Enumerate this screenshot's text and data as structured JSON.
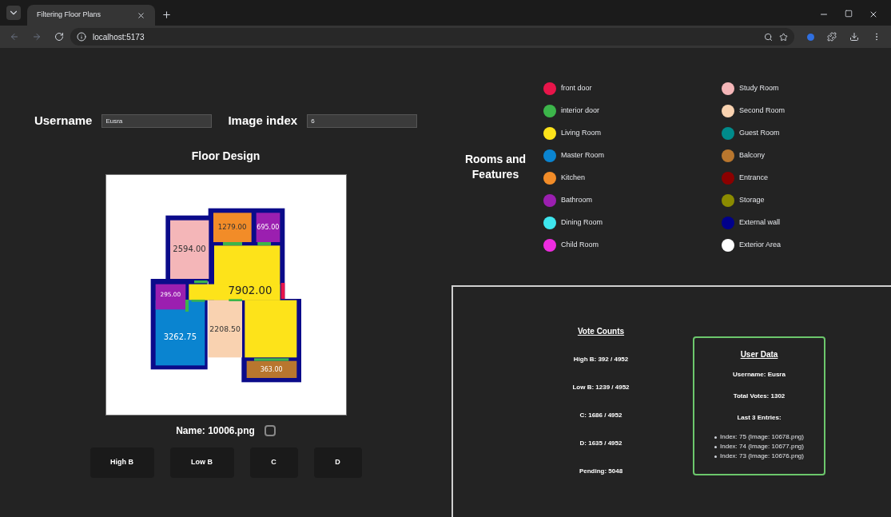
{
  "browser": {
    "tab_title": "Filtering Floor Plans",
    "url": "localhost:5173"
  },
  "form": {
    "username_label": "Username",
    "username_value": "Eusra",
    "image_index_label": "Image index",
    "image_index_value": "6"
  },
  "floor_plan": {
    "title": "Floor Design",
    "areas": [
      {
        "label": "1279.00",
        "color": "#f28c28"
      },
      {
        "label": "695.00",
        "color": "#9b1fb0"
      },
      {
        "label": "2594.00",
        "color": "#f4b6b8"
      },
      {
        "label": "295.00",
        "color": "#9b1fb0"
      },
      {
        "label": "7902.00",
        "color": "#fde31a"
      },
      {
        "label": "2208.50",
        "color": "#f9d2b0"
      },
      {
        "label": "3262.75",
        "color": "#0a84d0"
      },
      {
        "label": "363.00",
        "color": "#b8762e"
      }
    ]
  },
  "image_name": "Name: 10006.png",
  "image_checked": false,
  "vote_buttons": [
    "High B",
    "Low B",
    "C",
    "D"
  ],
  "legend": {
    "title": "Rooms and Features",
    "items": [
      {
        "label": "front door",
        "color": "#e8154a"
      },
      {
        "label": "interior door",
        "color": "#3cb54a"
      },
      {
        "label": "Living Room",
        "color": "#fde31a"
      },
      {
        "label": "Master Room",
        "color": "#0a84d0"
      },
      {
        "label": "Kitchen",
        "color": "#f28c28"
      },
      {
        "label": "Bathroom",
        "color": "#9b1fb0"
      },
      {
        "label": "Dining Room",
        "color": "#3ee6ee"
      },
      {
        "label": "Child Room",
        "color": "#ee2ce0"
      },
      {
        "label": "Study Room",
        "color": "#f4b6b8"
      },
      {
        "label": "Second Room",
        "color": "#f9d2b0"
      },
      {
        "label": "Guest Room",
        "color": "#008b8b"
      },
      {
        "label": "Balcony",
        "color": "#b8762e"
      },
      {
        "label": "Entrance",
        "color": "#8b0000"
      },
      {
        "label": "Storage",
        "color": "#8b8b00"
      },
      {
        "label": "External wall",
        "color": "#00008b"
      },
      {
        "label": "Exterior Area",
        "color": "#ffffff"
      }
    ]
  },
  "vote_counts": {
    "title": "Vote Counts",
    "lines": [
      "High B: 392 / 4952",
      "Low B: 1239 / 4952",
      "C: 1686 / 4952",
      "D: 1635 / 4952",
      "Pending: 5048"
    ]
  },
  "user_data": {
    "title": "User Data",
    "username": "Username: Eusra",
    "total_votes": "Total Votes: 1302",
    "entries_title": "Last 3 Entries:",
    "entries": [
      "Index: 75 (Image: 10678.png)",
      "Index: 74 (Image: 10677.png)",
      "Index: 73 (Image: 10676.png)"
    ]
  }
}
